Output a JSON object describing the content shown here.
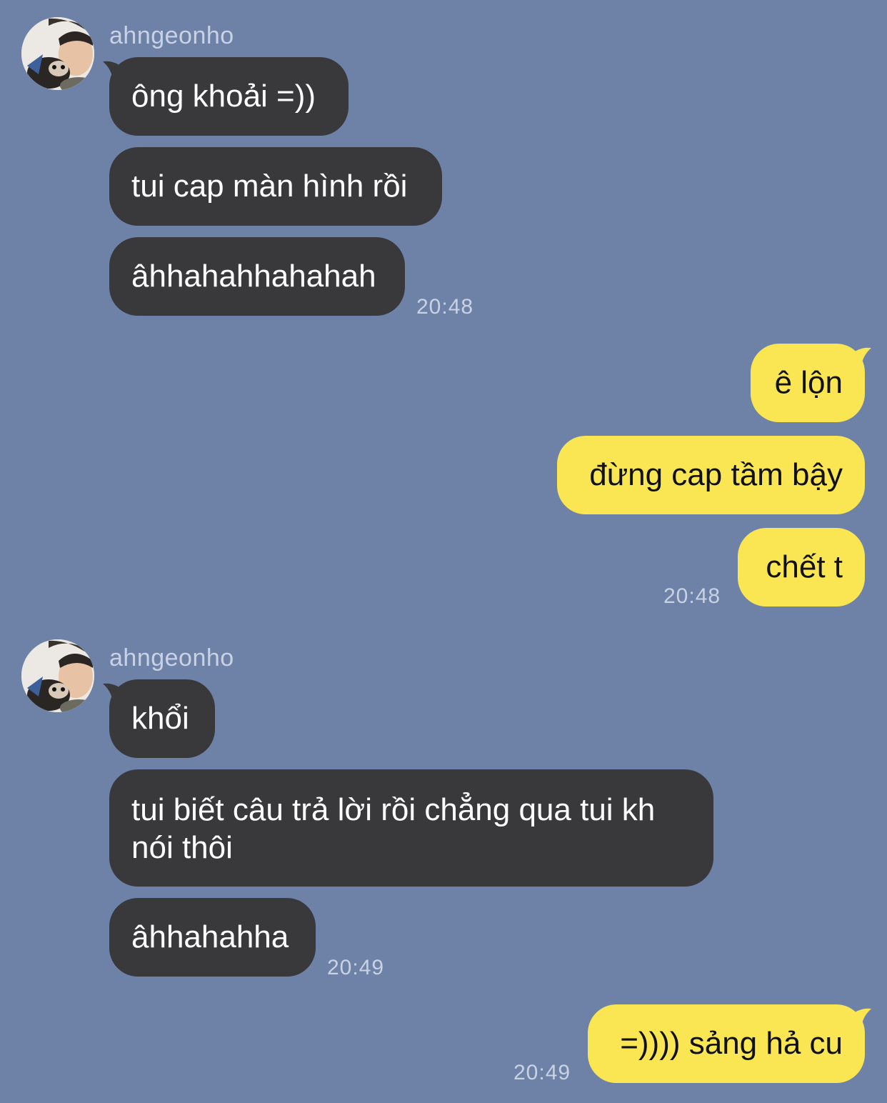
{
  "colors": {
    "background": "#6e82a8",
    "incoming_bubble": "#39393c",
    "outgoing_bubble": "#f9e652",
    "meta_text": "#c9d2e3"
  },
  "groups": [
    {
      "sender": "ahngeonho",
      "avatar": "avatar-icon",
      "messages": [
        "ông khoải =))",
        "tui cap màn hình rồi",
        "âhhahahhahahah"
      ],
      "time": "20:48"
    },
    {
      "sender": "",
      "messages": [
        "ê lộn",
        "đừng cap tầm bậy",
        "chết t"
      ],
      "time": "20:48"
    },
    {
      "sender": "ahngeonho",
      "avatar": "avatar-icon",
      "messages": [
        "khổi",
        "tui biết câu trả lời rồi chẳng qua tui kh nói thôi",
        "âhhahahha"
      ],
      "time": "20:49"
    },
    {
      "sender": "",
      "messages": [
        "=)))) sảng hả cu"
      ],
      "time": "20:49"
    }
  ]
}
